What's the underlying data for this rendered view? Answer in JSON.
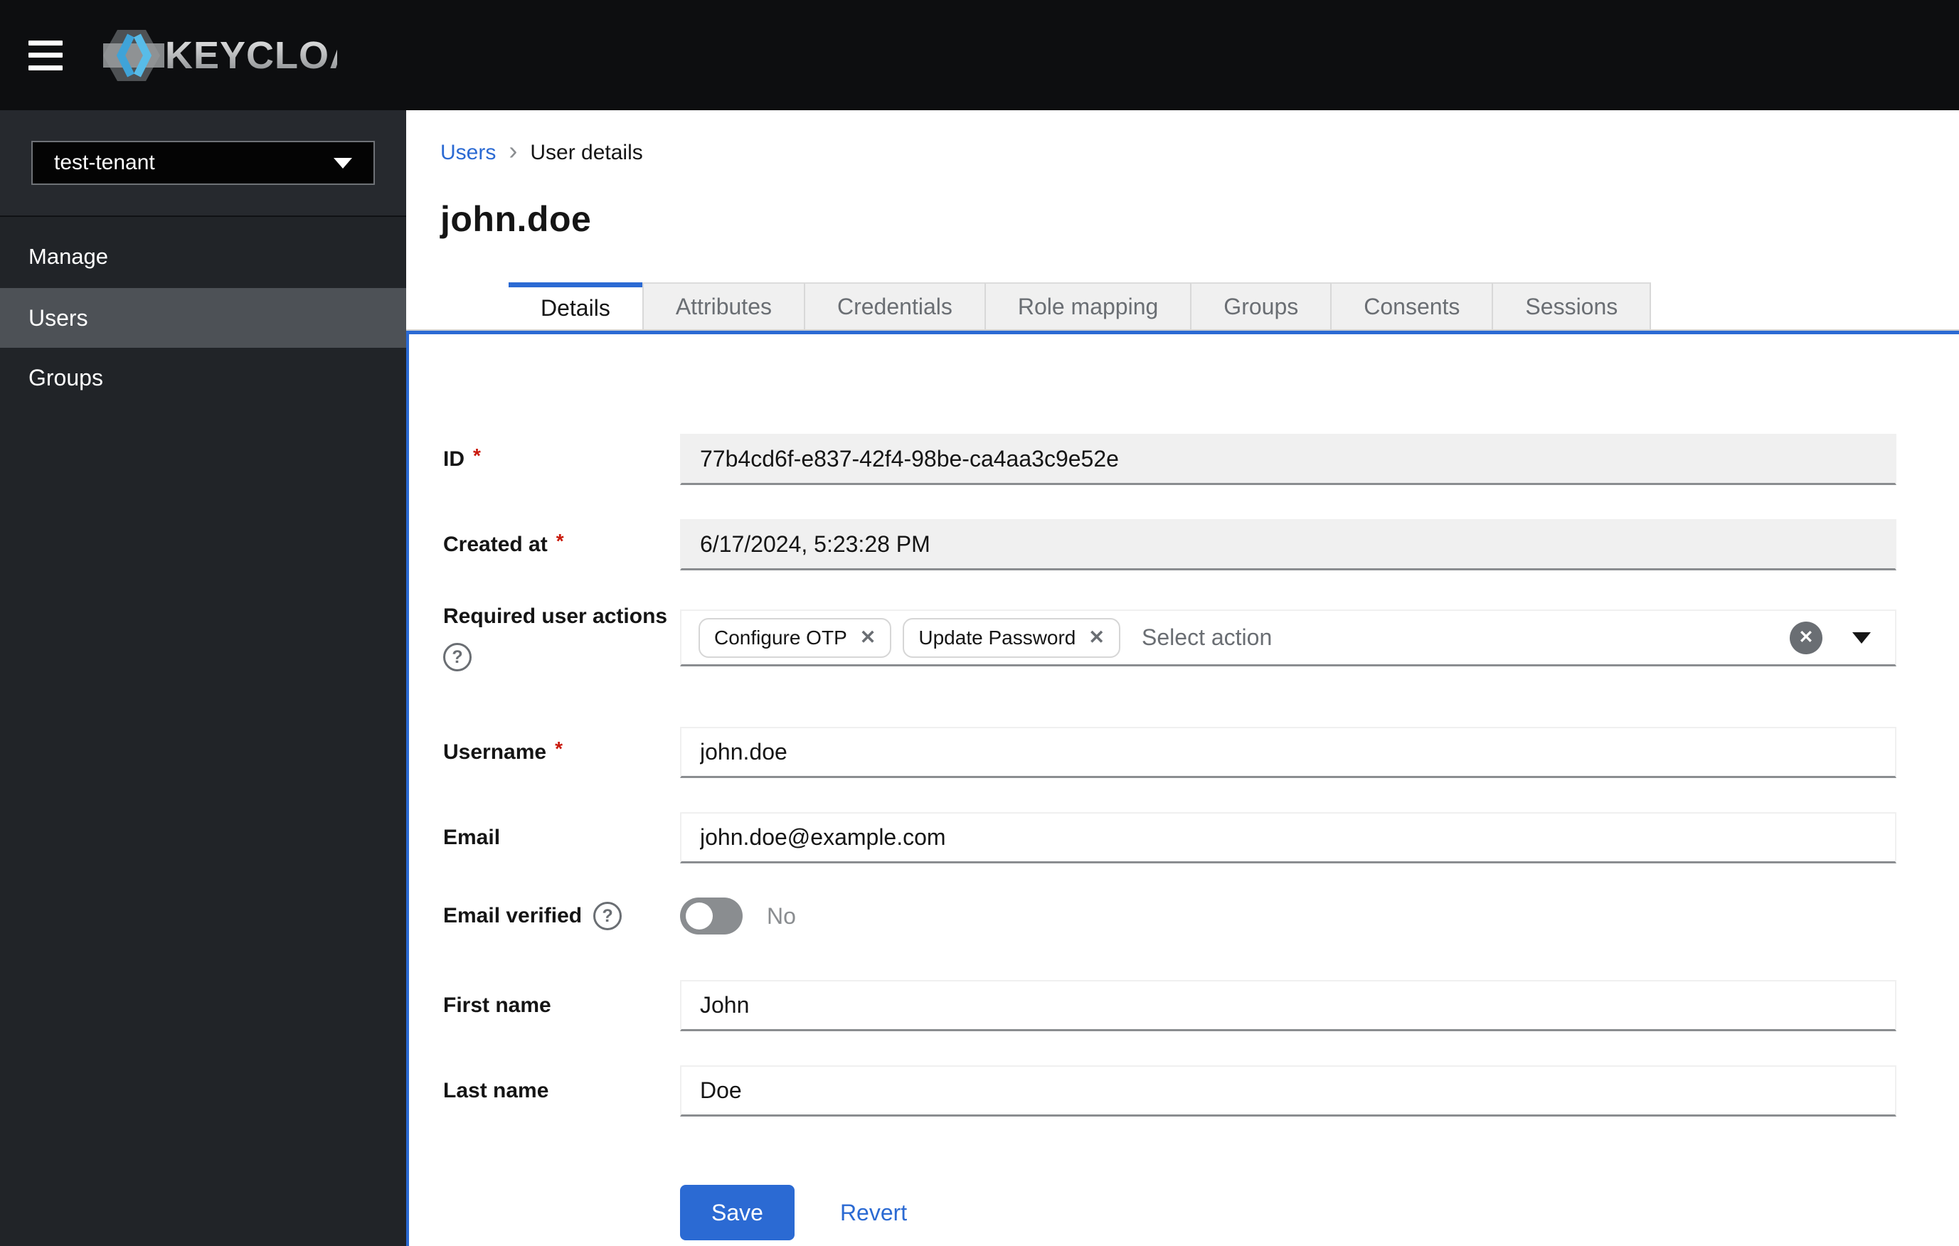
{
  "masthead": {
    "brand": "KEYCLOAK"
  },
  "sidebar": {
    "realm": "test-tenant",
    "section_title": "Manage",
    "nav": [
      "Users",
      "Groups"
    ],
    "active_item": "Users"
  },
  "breadcrumb": {
    "link": "Users",
    "separator": "›",
    "current": "User details"
  },
  "page_title": "john.doe",
  "tabs": {
    "active": "Details",
    "items": [
      "Details",
      "Attributes",
      "Credentials",
      "Role mapping",
      "Groups",
      "Consents",
      "Sessions"
    ]
  },
  "form": {
    "required_marker": "*",
    "rows": {
      "id": {
        "label": "ID",
        "required": true,
        "readonly": true,
        "value": "77b4cd6f-e837-42f4-98be-ca4aa3c9e52e"
      },
      "created_at": {
        "label": "Created at",
        "required": true,
        "readonly": true,
        "value": "6/17/2024, 5:23:28 PM"
      },
      "required_user_actions": {
        "label": "Required user actions",
        "chips": [
          "Configure OTP",
          "Update Password"
        ],
        "placeholder": "Select action"
      },
      "username": {
        "label": "Username",
        "required": true,
        "value": "john.doe"
      },
      "email": {
        "label": "Email",
        "value": "john.doe@example.com"
      },
      "email_verified": {
        "label": "Email verified",
        "state_label": "No",
        "enabled": false
      },
      "first_name": {
        "label": "First name",
        "value": "John"
      },
      "last_name": {
        "label": "Last name",
        "value": "Doe"
      }
    },
    "actions": {
      "save": "Save",
      "revert": "Revert"
    }
  },
  "icons": {
    "remove": "✕",
    "clear": "✕",
    "help": "?"
  },
  "colors": {
    "accent_blue": "#2b6ad3",
    "masthead_bg": "#0d0e10",
    "sidebar_bg": "#212428",
    "sidebar_selected": "#4d5156",
    "danger_red": "#c9190b",
    "muted_text": "#6a6e73",
    "disabled_bg": "#f0f0f0",
    "input_border_bottom": "#8a8d90"
  }
}
